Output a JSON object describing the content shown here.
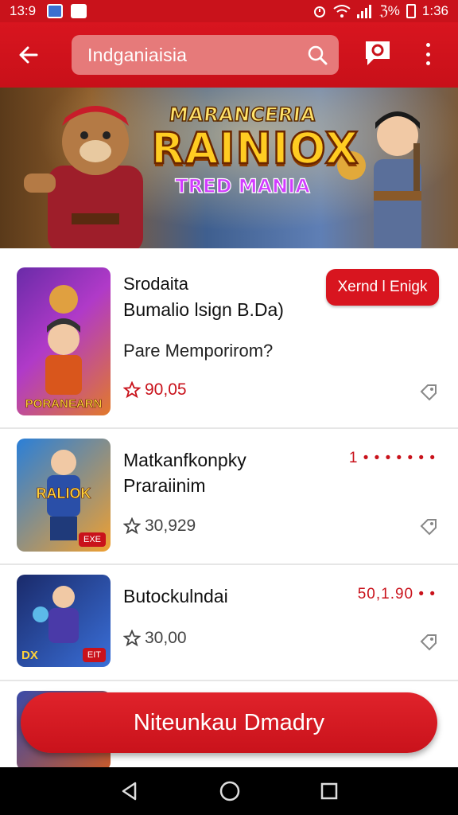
{
  "status_bar": {
    "time": "13:9",
    "right_text": "ℨ%",
    "right_time": "1:36"
  },
  "search": {
    "value": "Indganiaisia"
  },
  "banner": {
    "logo_line1": "MARANCERIA",
    "logo_line2": "RAINIOX",
    "logo_line3": "TRED MANIA"
  },
  "items": [
    {
      "title": "Srodaita",
      "subtitle": "Bumalio lsign B.Da)",
      "desc": "Pare Memporirom?",
      "rating": "90,05",
      "button": "Xernd l Enigk",
      "thumb_caption": "PORANEARN"
    },
    {
      "title": "Matkanfkonpky",
      "subtitle": "Praraiinim",
      "rating": "30,929",
      "price": "1 • • • • • • •",
      "thumb_caption": "RALIOK",
      "thumb_badge": "EXE"
    },
    {
      "title": "Butockulndai",
      "rating": "30,00",
      "price": "50,1.90 • •",
      "thumb_caption": "DX",
      "thumb_badge": "EIT"
    }
  ],
  "cta": {
    "label": "Niteunkau Dmadry"
  }
}
